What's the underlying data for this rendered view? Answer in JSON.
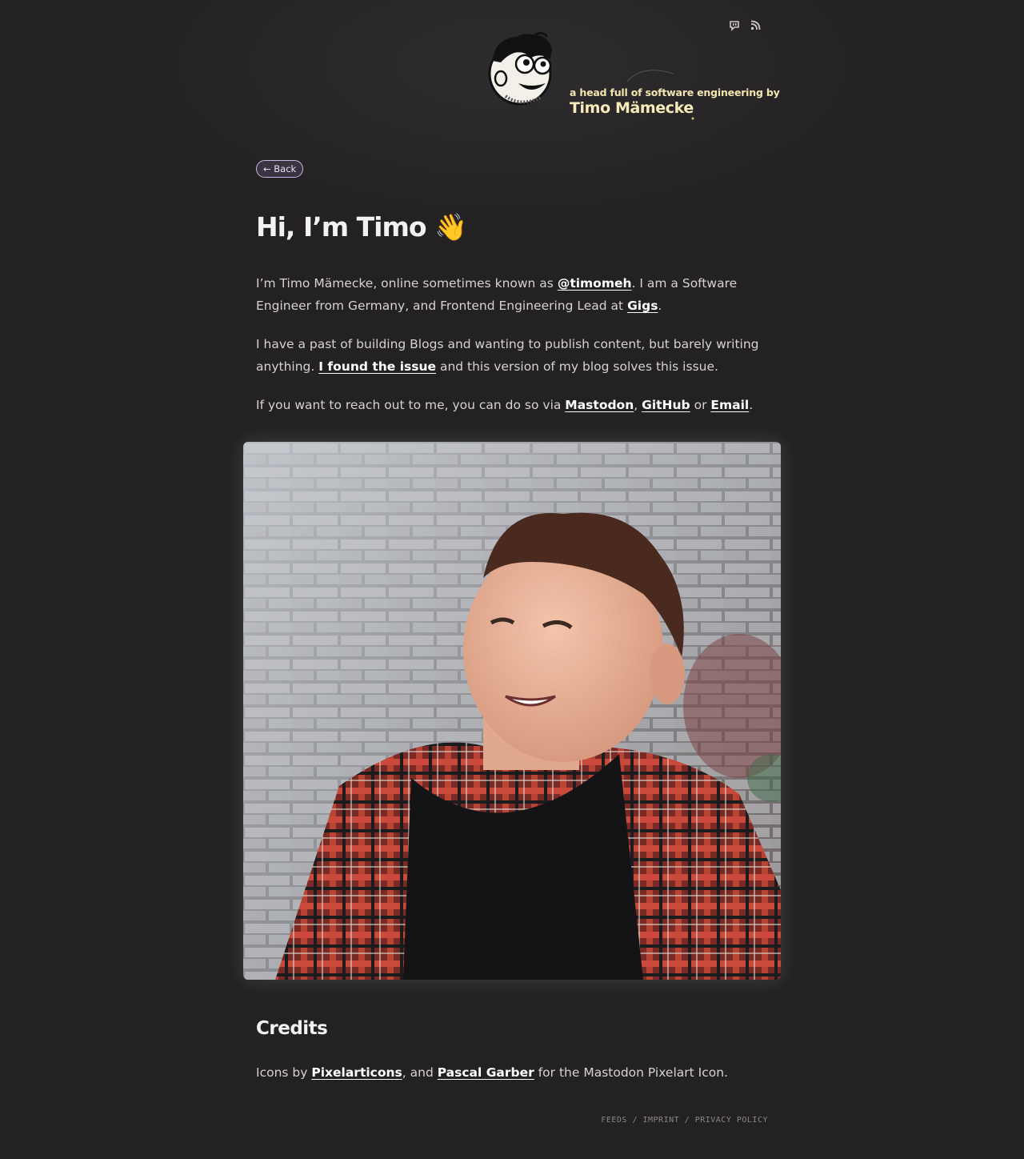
{
  "social": {
    "mastodon_icon": "mastodon-icon",
    "rss_icon": "rss-icon"
  },
  "header": {
    "tagline": "a head full of software engineering by",
    "site_name": "Timo Mämecke"
  },
  "back_label": "← Back",
  "heading": "Hi, I’m Timo 👋",
  "paragraphs": {
    "p1_a": "I’m Timo Mämecke, online sometimes known as ",
    "p1_link1": "@timomeh",
    "p1_b": ". I am a Software Engineer from Germany, and Frontend Engineering Lead at ",
    "p1_link2": "Gigs",
    "p1_c": ".",
    "p2_a": "I have a past of building Blogs and wanting to publish content, but barely writing anything. ",
    "p2_link": "I found the issue",
    "p2_b": " and this version of my blog solves this issue.",
    "p3_a": "If you want to reach out to me, you can do so via ",
    "p3_link1": "Mastodon",
    "p3_sep1": ", ",
    "p3_link2": "GitHub",
    "p3_sep2": " or ",
    "p3_link3": "Email",
    "p3_end": "."
  },
  "credits": {
    "heading": "Credits",
    "a": "Icons by ",
    "link1": "Pixelarticons",
    "b": ", and ",
    "link2": "Pascal Garber",
    "c": " for the Mastodon Pixelart Icon."
  },
  "footer": {
    "feeds": "FEEDS",
    "sep": " / ",
    "imprint": "IMPRINT",
    "privacy": "PRIVACY POLICY"
  }
}
